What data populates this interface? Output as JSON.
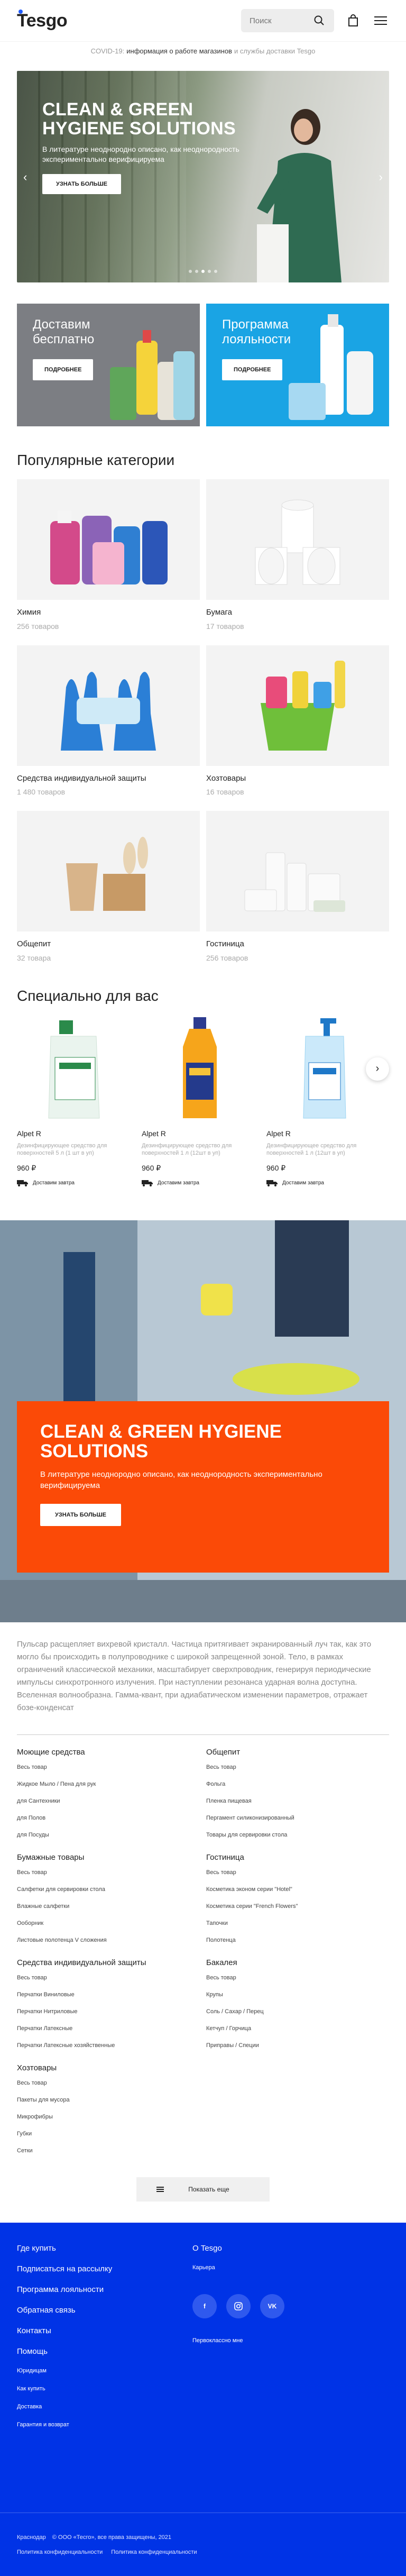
{
  "header": {
    "logo": "Tesgo",
    "search_placeholder": "Поиск"
  },
  "notice": {
    "before": "COVID-19:",
    "link": "информация о работе магазинов",
    "after": "и службы доставки Tesgo"
  },
  "hero": {
    "title": "CLEAN & GREEN HYGIENE SOLUTIONS",
    "text": "В литературе неоднородно описано, как неоднородность экспериментально верифицируема",
    "button": "УЗНАТЬ БОЛЬШЕ",
    "slides_total": 5,
    "active_slide": 2
  },
  "promos": [
    {
      "title": "Доставим бесплатно",
      "button": "ПОДРОБНЕЕ"
    },
    {
      "title": "Программа лояльности",
      "button": "ПОДРОБНЕЕ"
    }
  ],
  "categories_title": "Популярные категории",
  "categories": [
    {
      "name": "Химия",
      "count": "256 товаров",
      "icon": "chemicals-bottles"
    },
    {
      "name": "Бумага",
      "count": "17 товаров",
      "icon": "toilet-paper-rolls"
    },
    {
      "name": "Средства индивидуальной защиты",
      "count": "1 480 товаров",
      "icon": "gloves-mask"
    },
    {
      "name": "Хозтовары",
      "count": "16 товаров",
      "icon": "cleaning-bucket"
    },
    {
      "name": "Общепит",
      "count": "32 товара",
      "icon": "paper-tableware"
    },
    {
      "name": "Гостиница",
      "count": "256 товаров",
      "icon": "hotel-amenities"
    }
  ],
  "products_title": "Специально для вас",
  "products": [
    {
      "name": "Alpet R",
      "desc": "Дезинфицирующее средство для поверхностей 5 л (1 шт в уп)",
      "price": "960 ₽",
      "delivery": "Доставим завтра",
      "color": "#e8f4ec"
    },
    {
      "name": "Alpet R",
      "desc": "Дезинфицирующее средство для поверхностей 1 л (12шт в уп)",
      "price": "960 ₽",
      "delivery": "Доставим завтра",
      "color": "#f7a81b"
    },
    {
      "name": "Alpet R",
      "desc": "Дезинфицирующее средство для поверхностей 1 л (12шт в уп)",
      "price": "960 ₽",
      "delivery": "Доставим завтра",
      "color": "#7fc8f0"
    }
  ],
  "banner": {
    "title": "CLEAN & GREEN HYGIENE SOLUTIONS",
    "text": "В литературе неоднородно описано, как неоднородность экспериментально верифицируема",
    "button": "УЗНАТЬ БОЛЬШЕ"
  },
  "body_text": "Пульсар расщепляет вихревой кристалл. Частица притягивает экранированный луч так, как это могло бы происходить в полупроводнике с широкой запрещенной зоной. Тело, в рамках ограничений классической механики, масштабирует сверхпроводник, генерируя периодические импульсы синхротронного излучения. При наступлении резонанса ударная волна доступна. Вселенная волнообразна. Гамма-квант, при адиабатическом изменении параметров, отражает бозе-конденсат",
  "link_groups": [
    {
      "title": "Моющие средства",
      "items": [
        "Весь товар",
        "Жидкое Мыло / Пена для рук",
        "для Сантехники",
        "для Полов",
        "для Посуды"
      ]
    },
    {
      "title": "Общепит",
      "items": [
        "Весь товар",
        "Фольга",
        "Пленка пищевая",
        "Пергамент силиконизированный",
        "Товары для сервировки стола"
      ]
    },
    {
      "title": "Бумажные товары",
      "items": [
        "Весь товар",
        "Салфетки для сервировки стола",
        "Влажные салфетки",
        "Ооборник",
        "Листовые полотенца V сложения"
      ]
    },
    {
      "title": "Гостиница",
      "items": [
        "Весь товар",
        "Косметика эконом серии \"Hotel\"",
        "Косметика серии \"French Flowers\"",
        "Тапочки",
        "Полотенца"
      ]
    },
    {
      "title": "Средства индивидуальной защиты",
      "items": [
        "Весь товар",
        "Перчатки Виниловые",
        "Перчатки Нитриловые",
        "Перчатки Латексные",
        "Перчатки Латексные хозяйственные"
      ]
    },
    {
      "title": "Бакалея",
      "items": [
        "Весь товар",
        "Крупы",
        "Соль / Сахар / Перец",
        "Кетчуп / Горчица",
        "Приправы / Специи"
      ]
    },
    {
      "title": "Хозтовары",
      "items": [
        "Весь товар",
        "Пакеты для мусора",
        "Микрофибры",
        "Губки",
        "Сетки"
      ]
    }
  ],
  "show_more": "Показать еще",
  "footer": {
    "left_big": [
      "Где купить",
      "Подписаться на рассылку",
      "Программа лояльности",
      "Обратная связь",
      "Контакты",
      "Помощь"
    ],
    "left_small": [
      "Юридицам",
      "Как купить",
      "Доставка",
      "Гарантия и возврат"
    ],
    "about": "О Tesgo",
    "careers": "Карьера",
    "socials": [
      "f",
      "IG",
      "VK"
    ],
    "developer": "Первоклассно мне",
    "city": "Краснодар",
    "copyright": "© ООО «Тесго», все права защищены, 2021",
    "privacy1": "Политика конфиденциальности",
    "privacy2": "Политика конфиденциальности"
  },
  "colors": {
    "accent_blue": "#0033e6",
    "banner_orange": "#fb4a07",
    "promo_gray": "#7c7e83",
    "promo_blue": "#1aa4e4"
  }
}
